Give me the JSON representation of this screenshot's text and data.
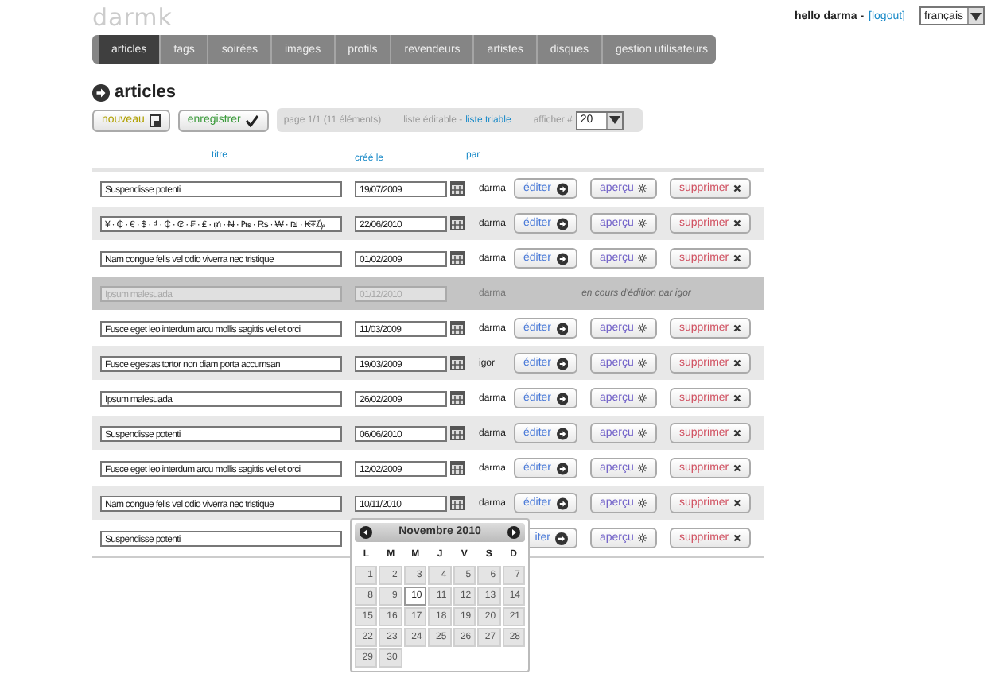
{
  "header": {
    "logo": "darmk",
    "greeting": "hello darma -",
    "logout_link": "[logout]",
    "language": "français"
  },
  "nav": [
    {
      "label": "articles",
      "selected": true
    },
    {
      "label": "tags",
      "selected": false
    },
    {
      "label": "soirées",
      "selected": false
    },
    {
      "label": "images",
      "selected": false
    },
    {
      "label": "profils",
      "selected": false
    },
    {
      "label": "revendeurs",
      "selected": false
    },
    {
      "label": "artistes",
      "selected": false
    },
    {
      "label": "disques",
      "selected": false
    },
    {
      "label": "gestion utilisateurs",
      "selected": false
    }
  ],
  "page_title": "articles",
  "toolbar": {
    "new_button": "nouveau",
    "save_button": "enregistrer",
    "pagination": "page 1/1 (11 éléments)",
    "mode_label": "liste éditable -",
    "sortable_link": "liste triable",
    "per_page_label": "afficher #",
    "per_page": "20"
  },
  "columns": [
    "titre",
    "créé le",
    "par"
  ],
  "rows": [
    {
      "kind": "editable",
      "title": "Suspendisse potenti",
      "date": "19/07/2009",
      "author": "darma",
      "edit": "éditer",
      "preview": "aperçu",
      "delete": "supprimer",
      "picker_open": false
    },
    {
      "kind": "editable",
      "title": "¥ · ₵ · € · $ · ₫ · ₵ · ₢ · ₣ · ₤ · ₥ · ₦ · ₧ · ₨ · ₩ · ₪ · ₭₮₯",
      "date": "22/06/2010",
      "author": "darma",
      "edit": "éditer",
      "preview": "aperçu",
      "delete": "supprimer",
      "picker_open": false
    },
    {
      "kind": "editable",
      "title": "Nam congue felis vel odio viverra nec tristique",
      "date": "01/02/2009",
      "author": "darma",
      "edit": "éditer",
      "preview": "aperçu",
      "delete": "supprimer",
      "picker_open": false
    },
    {
      "kind": "locked",
      "title": "Ipsum malesuada",
      "date": "01/12/2010",
      "author": "darma",
      "message": "en cours d'édition par igor"
    },
    {
      "kind": "editable",
      "title": "Fusce eget leo interdum arcu mollis sagittis vel et orci",
      "date": "11/03/2009",
      "author": "darma",
      "edit": "éditer",
      "preview": "aperçu",
      "delete": "supprimer",
      "picker_open": false
    },
    {
      "kind": "editable",
      "title": "Fusce egestas tortor non diam porta accumsan",
      "date": "19/03/2009",
      "author": "igor",
      "edit": "éditer",
      "preview": "aperçu",
      "delete": "supprimer",
      "picker_open": false
    },
    {
      "kind": "editable",
      "title": "Ipsum malesuada",
      "date": "26/02/2009",
      "author": "darma",
      "edit": "éditer",
      "preview": "aperçu",
      "delete": "supprimer",
      "picker_open": false
    },
    {
      "kind": "editable",
      "title": "Suspendisse potenti",
      "date": "06/06/2010",
      "author": "darma",
      "edit": "éditer",
      "preview": "aperçu",
      "delete": "supprimer",
      "picker_open": false
    },
    {
      "kind": "editable",
      "title": "Fusce eget leo interdum arcu mollis sagittis vel et orci",
      "date": "12/02/2009",
      "author": "darma",
      "edit": "éditer",
      "preview": "aperçu",
      "delete": "supprimer",
      "picker_open": false
    },
    {
      "kind": "editable",
      "title": "Nam congue felis vel odio viverra nec tristique",
      "date": "10/11/2010",
      "author": "darma",
      "edit": "éditer",
      "preview": "aperçu",
      "delete": "supprimer",
      "picker_open": true
    },
    {
      "kind": "editable",
      "title": "Suspendisse potenti",
      "edit": "iter",
      "preview": "aperçu",
      "delete": "supprimer",
      "picker_open": false
    }
  ],
  "date_picker": {
    "month": "Novembre 2010",
    "weekdays": [
      "L",
      "M",
      "M",
      "J",
      "V",
      "S",
      "D"
    ],
    "days": [
      {
        "label": "1",
        "selected": false
      },
      {
        "label": "2",
        "selected": false
      },
      {
        "label": "3",
        "selected": false
      },
      {
        "label": "4",
        "selected": false
      },
      {
        "label": "5",
        "selected": false
      },
      {
        "label": "6",
        "selected": false
      },
      {
        "label": "7",
        "selected": false
      },
      {
        "label": "8",
        "selected": false
      },
      {
        "label": "9",
        "selected": false
      },
      {
        "label": "10",
        "selected": true
      },
      {
        "label": "11",
        "selected": false
      },
      {
        "label": "12",
        "selected": false
      },
      {
        "label": "13",
        "selected": false
      },
      {
        "label": "14",
        "selected": false
      },
      {
        "label": "15",
        "selected": false
      },
      {
        "label": "16",
        "selected": false
      },
      {
        "label": "17",
        "selected": false
      },
      {
        "label": "18",
        "selected": false
      },
      {
        "label": "19",
        "selected": false
      },
      {
        "label": "20",
        "selected": false
      },
      {
        "label": "21",
        "selected": false
      },
      {
        "label": "22",
        "selected": false
      },
      {
        "label": "23",
        "selected": false
      },
      {
        "label": "24",
        "selected": false
      },
      {
        "label": "25",
        "selected": false
      },
      {
        "label": "26",
        "selected": false
      },
      {
        "label": "27",
        "selected": false
      },
      {
        "label": "28",
        "selected": false
      },
      {
        "label": "29",
        "selected": false
      },
      {
        "label": "30",
        "selected": false
      }
    ]
  }
}
